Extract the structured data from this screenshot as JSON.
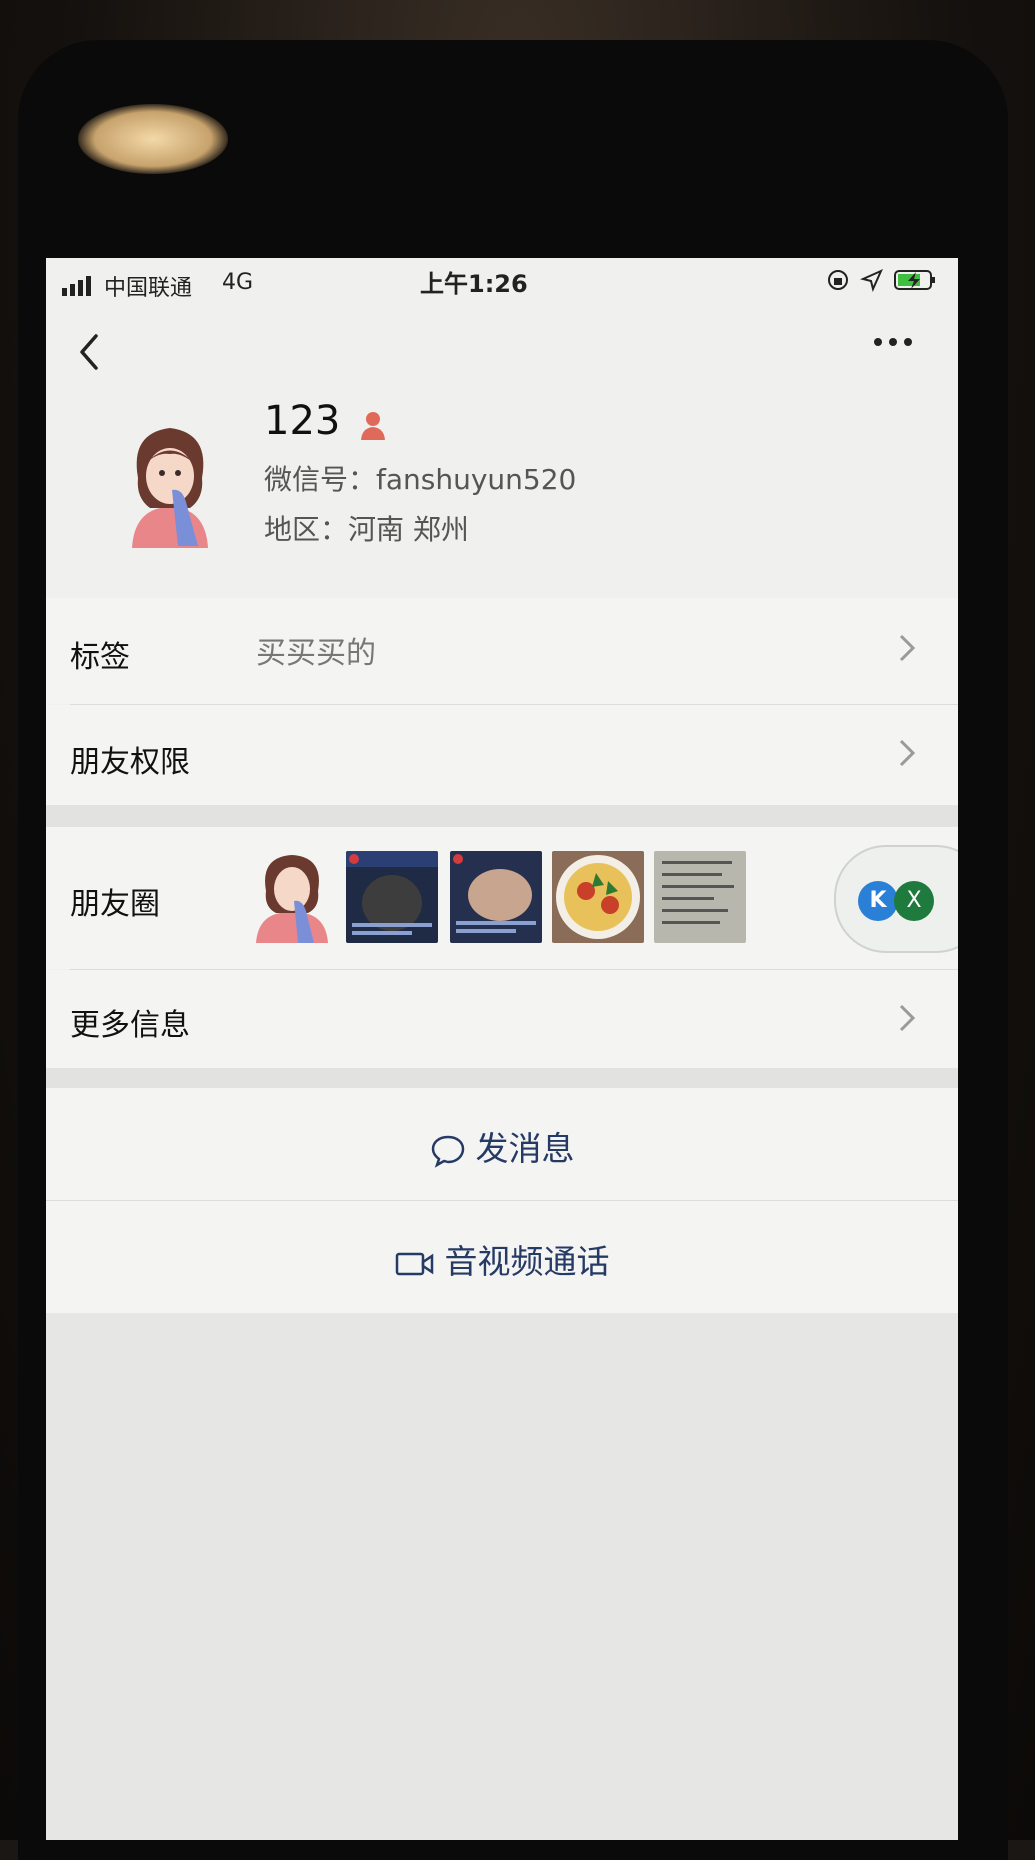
{
  "status_bar": {
    "carrier": "中国联通",
    "network": "4G",
    "time": "上午1:26"
  },
  "profile": {
    "name": "123",
    "wechat_id": "微信号：fanshuyun520",
    "region": "地区：河南 郑州"
  },
  "rows": {
    "tags_label": "标签",
    "tags_value": "买买买的",
    "permissions_label": "朋友权限",
    "moments_label": "朋友圈",
    "more_info_label": "更多信息"
  },
  "actions": {
    "message_label": "发消息",
    "call_label": "音视频通话"
  },
  "floating_button": {
    "left_letter": "K",
    "right_letter": "X"
  },
  "colors": {
    "accent_text": "#263a66",
    "gender_icon": "#e06a5a"
  }
}
